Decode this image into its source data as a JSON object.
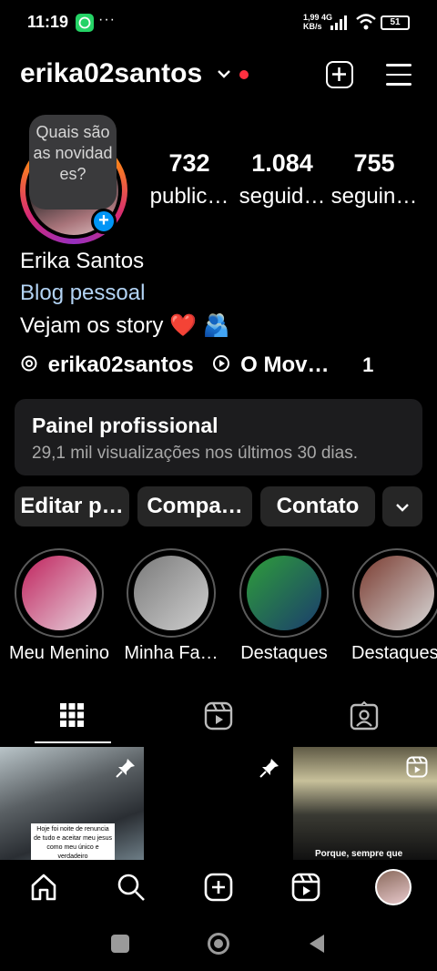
{
  "status_bar": {
    "time": "11:19",
    "net_speed_value": "1,99",
    "net_speed_unit": "KB/s",
    "net_type": "4G",
    "battery": "51",
    "more_dots": "···"
  },
  "header": {
    "username": "erika02santos"
  },
  "profile": {
    "bubble_text": "Quais são as novidad es?",
    "stats": [
      {
        "value": "732",
        "label": "public…"
      },
      {
        "value": "1.084",
        "label": "seguid…"
      },
      {
        "value": "755",
        "label": "seguin…"
      }
    ],
    "name": "Erika Santos",
    "category": "Blog pessoal",
    "bio": "Vejam os story ❤️ 🫂",
    "threads_handle": "erika02santos",
    "music": "O Mov…",
    "extra_count": "1"
  },
  "pro_panel": {
    "title": "Painel profissional",
    "subtitle": "29,1 mil visualizações nos últimos 30 dias."
  },
  "buttons": {
    "edit": "Editar p…",
    "share": "Compa…",
    "contact": "Contato"
  },
  "highlights": [
    {
      "label": "Meu Menino",
      "color_a": "#c0235d",
      "color_b": "#e6d3dd"
    },
    {
      "label": "Minha Fa…",
      "color_a": "#7a7a7a",
      "color_b": "#cfcfcf"
    },
    {
      "label": "Destaques",
      "color_a": "#2e9e3a",
      "color_b": "#1b3c6d"
    },
    {
      "label": "Destaques",
      "color_a": "#7a3b30",
      "color_b": "#d8d8d8"
    }
  ],
  "posts": [
    {
      "caption": "Hoje foi noite de renuncia de tudo e aceitar meu jesus como meu único e verdadeiro",
      "pinned": true
    },
    {
      "caption": "",
      "pinned": true
    },
    {
      "caption": "Porque, sempre que",
      "reel": true
    }
  ],
  "colors": {
    "accent_blue": "#0095f6",
    "panel_bg": "#1c1c1e",
    "button_bg": "#262626",
    "category_blue": "#b3d4f5"
  }
}
